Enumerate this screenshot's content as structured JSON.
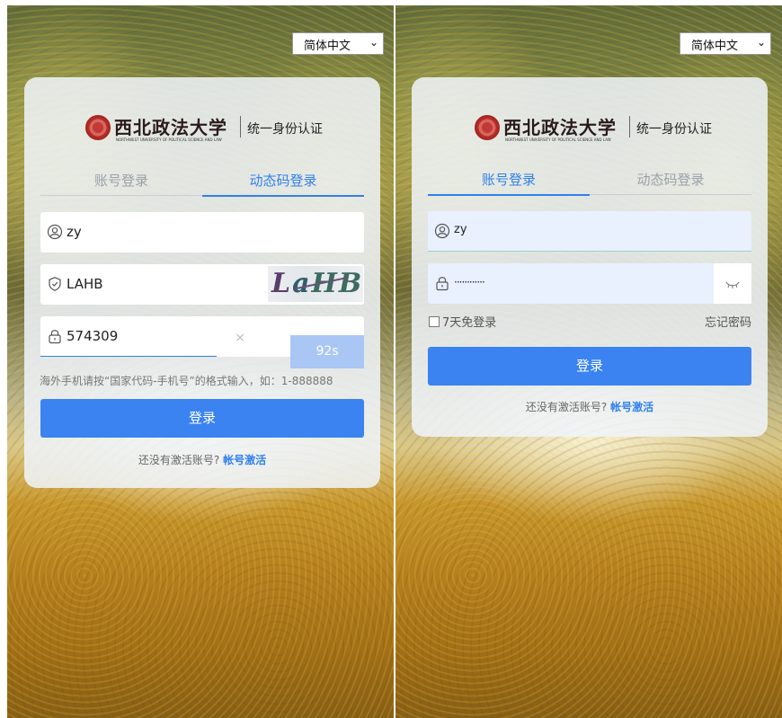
{
  "left": {
    "language": "简体中文",
    "brand": {
      "name": "西北政法大学",
      "english": "NORTHWEST UNIVERSITY OF POLITICAL SCIENCE AND LAW",
      "subtitle": "统一身份认证"
    },
    "tabs": [
      {
        "label": "账号登录",
        "active": false
      },
      {
        "label": "动态码登录",
        "active": true
      }
    ],
    "username": "zy",
    "captcha_input": "LAHB",
    "captcha_image": [
      "L",
      "a",
      "HB"
    ],
    "code_input": "574309",
    "clear": "×",
    "countdown": "92s",
    "hint": "海外手机请按“国家代码-手机号”的格式输入，如：1-888888",
    "login_label": "登录",
    "activate_text": "还没有激活账号?",
    "activate_link": "帐号激活"
  },
  "right": {
    "language": "简体中文",
    "brand": {
      "name": "西北政法大学",
      "english": "NORTHWEST UNIVERSITY OF POLITICAL SCIENCE AND LAW",
      "subtitle": "统一身份认证"
    },
    "tabs": [
      {
        "label": "账号登录",
        "active": true
      },
      {
        "label": "动态码登录",
        "active": false
      }
    ],
    "username": "zy",
    "password": "············",
    "remember_label": "7天免登录",
    "forgot_label": "忘记密码",
    "login_label": "登录",
    "activate_text": "还没有激活账号?",
    "activate_link": "帐号激活"
  },
  "icons": {
    "user": "user-circle-icon",
    "shield": "shield-check-icon",
    "lock": "lock-icon",
    "eye": "eye-closed-icon",
    "chevron": "chevron-down-icon"
  },
  "colors": {
    "accent": "#3a83f1",
    "countdown": "#a9c6f5"
  }
}
